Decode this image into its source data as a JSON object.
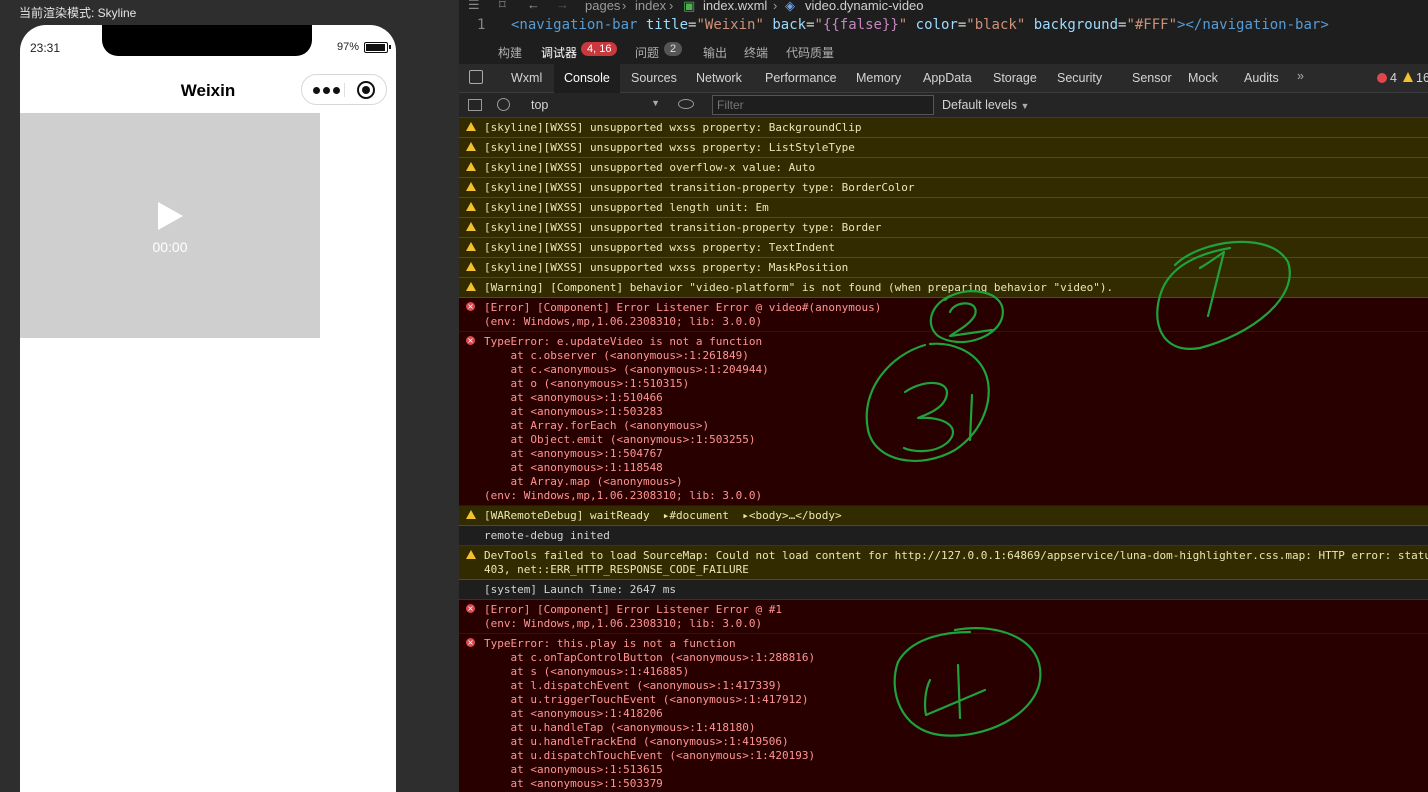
{
  "simulator": {
    "render_mode_label": "当前渲染模式: Skyline",
    "status_time": "23:31",
    "battery": "97%",
    "battery_level": 0.97,
    "nav_title": "Weixin",
    "video_time": "00:00"
  },
  "editor": {
    "breadcrumb": [
      "pages",
      "index",
      "index.wxml",
      "video.dynamic-video"
    ],
    "line_number": "1",
    "code_line": {
      "tag_open": "<navigation-bar",
      "attr1": "title",
      "val1": "\"Weixin\"",
      "attr2": "back",
      "val2a": "\"",
      "val2b": "{{false}}",
      "val2c": "\"",
      "attr3": "color",
      "val3": "\"black\"",
      "attr4": "background",
      "val4": "\"#FFF\"",
      "tag_close": "></navigation-bar>"
    }
  },
  "panel_tabs": {
    "build": "构建",
    "debugger": "调试器",
    "debugger_badge": "4, 16",
    "issues": "问题",
    "issues_badge": "2",
    "output": "输出",
    "terminal": "终端",
    "code_quality": "代码质量"
  },
  "devtools_tabs": [
    "Wxml",
    "Console",
    "Sources",
    "Network",
    "Performance",
    "Memory",
    "AppData",
    "Storage",
    "Security",
    "Sensor",
    "Mock",
    "Audits"
  ],
  "devtools_active_tab": "Console",
  "devtools_counts": {
    "errors": "4",
    "warnings": "16"
  },
  "toolbar": {
    "context": "top",
    "filter_placeholder": "Filter",
    "levels": "Default levels"
  },
  "console": [
    {
      "level": "warn",
      "lines": [
        "[skyline][WXSS] unsupported wxss property: BackgroundClip"
      ]
    },
    {
      "level": "warn",
      "lines": [
        "[skyline][WXSS] unsupported wxss property: ListStyleType"
      ]
    },
    {
      "level": "warn",
      "lines": [
        "[skyline][WXSS] unsupported overflow-x value: Auto"
      ]
    },
    {
      "level": "warn",
      "lines": [
        "[skyline][WXSS] unsupported transition-property type: BorderColor"
      ]
    },
    {
      "level": "warn",
      "lines": [
        "[skyline][WXSS] unsupported length unit: Em"
      ]
    },
    {
      "level": "warn",
      "lines": [
        "[skyline][WXSS] unsupported transition-property type: Border"
      ]
    },
    {
      "level": "warn",
      "lines": [
        "[skyline][WXSS] unsupported wxss property: TextIndent"
      ]
    },
    {
      "level": "warn",
      "lines": [
        "[skyline][WXSS] unsupported wxss property: MaskPosition"
      ]
    },
    {
      "level": "warn",
      "lines": [
        "[Warning] [Component] behavior \"video-platform\" is not found (when preparing behavior \"video\")."
      ]
    },
    {
      "level": "err",
      "lines": [
        "[Error] [Component] Error Listener Error @ video#(anonymous)",
        "(env: Windows,mp,1.06.2308310; lib: 3.0.0)"
      ]
    },
    {
      "level": "err",
      "lines": [
        "TypeError: e.updateVideo is not a function",
        "    at c.observer (<anonymous>:1:261849)",
        "    at c.<anonymous> (<anonymous>:1:204944)",
        "    at o (<anonymous>:1:510315)",
        "    at <anonymous>:1:510466",
        "    at <anonymous>:1:503283",
        "    at Array.forEach (<anonymous>)",
        "    at Object.emit (<anonymous>:1:503255)",
        "    at <anonymous>:1:504767",
        "    at <anonymous>:1:118548",
        "    at Array.map (<anonymous>)",
        "(env: Windows,mp,1.06.2308310; lib: 3.0.0)"
      ]
    },
    {
      "level": "warn",
      "lines": [
        "[WARemoteDebug] waitReady  ▸#document  ▸<body>…</body>"
      ]
    },
    {
      "level": "plain",
      "lines": [
        "remote-debug inited"
      ]
    },
    {
      "level": "warn",
      "lines": [
        "DevTools failed to load SourceMap: Could not load content for http://127.0.0.1:64869/appservice/luna-dom-highlighter.css.map: HTTP error: status code",
        "403, net::ERR_HTTP_RESPONSE_CODE_FAILURE"
      ]
    },
    {
      "level": "plain",
      "lines": [
        "[system] Launch Time: 2647 ms"
      ]
    },
    {
      "level": "err",
      "lines": [
        "[Error] [Component] Error Listener Error @ #1",
        "(env: Windows,mp,1.06.2308310; lib: 3.0.0)"
      ]
    },
    {
      "level": "err",
      "lines": [
        "TypeError: this.play is not a function",
        "    at c.onTapControlButton (<anonymous>:1:288816)",
        "    at s (<anonymous>:1:416885)",
        "    at l.dispatchEvent (<anonymous>:1:417339)",
        "    at u.triggerTouchEvent (<anonymous>:1:417912)",
        "    at <anonymous>:1:418206",
        "    at u.handleTap (<anonymous>:1:418180)",
        "    at u.handleTrackEnd (<anonymous>:1:419506)",
        "    at u.dispatchTouchEvent (<anonymous>:1:420193)",
        "    at <anonymous>:1:513615",
        "    at <anonymous>:1:503379"
      ]
    }
  ],
  "annotations": [
    "1",
    "2",
    "3",
    "4"
  ],
  "colors": {
    "warn_bg": "#332b00",
    "err_bg": "#290000",
    "annotation": "#1fa23a",
    "badge_red": "#c8383d"
  }
}
